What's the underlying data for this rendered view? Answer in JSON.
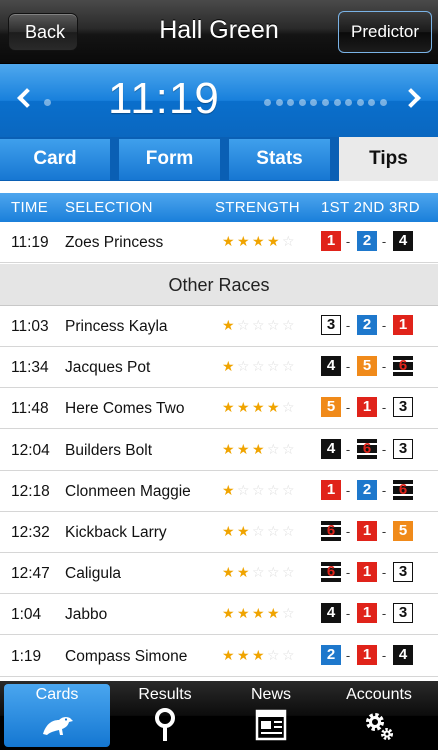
{
  "nav": {
    "back_label": "Back",
    "title": "Hall Green",
    "predictor_label": "Predictor"
  },
  "time_bar": {
    "time": "11:19",
    "dots_left": 1,
    "dots_right": 11
  },
  "tabs": [
    {
      "label": "Card",
      "active": false
    },
    {
      "label": "Form",
      "active": false
    },
    {
      "label": "Stats",
      "active": false
    },
    {
      "label": "Tips",
      "active": true
    }
  ],
  "columns": {
    "time": "TIME",
    "selection": "SELECTION",
    "strength": "STRENGTH",
    "places": "1ST 2ND 3RD"
  },
  "tip": {
    "time": "11:19",
    "selection": "Zoes Princess",
    "strength": 4,
    "traps": [
      "1",
      "2",
      "4"
    ]
  },
  "other_races_label": "Other Races",
  "races": [
    {
      "time": "11:03",
      "selection": "Princess Kayla",
      "strength": 1,
      "traps": [
        "3",
        "2",
        "1"
      ]
    },
    {
      "time": "11:34",
      "selection": "Jacques Pot",
      "strength": 1,
      "traps": [
        "4",
        "5",
        "6"
      ]
    },
    {
      "time": "11:48",
      "selection": "Here Comes Two",
      "strength": 4,
      "traps": [
        "5",
        "1",
        "3"
      ]
    },
    {
      "time": "12:04",
      "selection": "Builders Bolt",
      "strength": 3,
      "traps": [
        "4",
        "6",
        "3"
      ]
    },
    {
      "time": "12:18",
      "selection": "Clonmeen Maggie",
      "strength": 1,
      "traps": [
        "1",
        "2",
        "6"
      ]
    },
    {
      "time": "12:32",
      "selection": "Kickback Larry",
      "strength": 2,
      "traps": [
        "6",
        "1",
        "5"
      ]
    },
    {
      "time": "12:47",
      "selection": "Caligula",
      "strength": 2,
      "traps": [
        "6",
        "1",
        "3"
      ]
    },
    {
      "time": "1:04",
      "selection": "Jabbo",
      "strength": 4,
      "traps": [
        "4",
        "1",
        "3"
      ]
    },
    {
      "time": "1:19",
      "selection": "Compass Simone",
      "strength": 3,
      "traps": [
        "2",
        "1",
        "4"
      ]
    }
  ],
  "tabbar": [
    {
      "label": "Cards",
      "icon": "greyhound-icon",
      "active": true
    },
    {
      "label": "Results",
      "icon": "pin-icon",
      "active": false
    },
    {
      "label": "News",
      "icon": "newspaper-icon",
      "active": false
    },
    {
      "label": "Accounts",
      "icon": "gears-icon",
      "active": false
    }
  ],
  "colors": {
    "accent_blue": "#1a7fda",
    "star": "#f0a400",
    "trap1": "#e0231a",
    "trap2": "#1e78cc",
    "trap5": "#f08a1a"
  }
}
